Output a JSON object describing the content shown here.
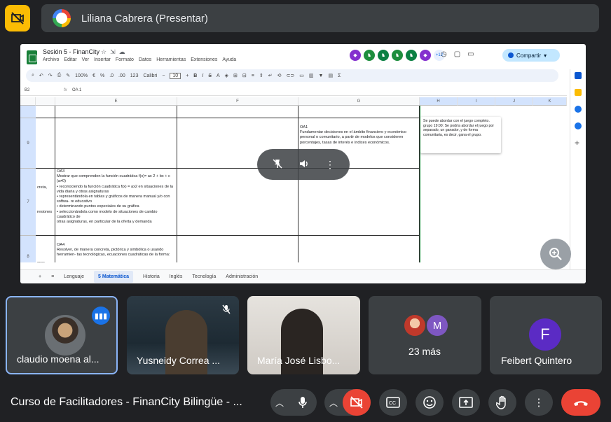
{
  "presenter": {
    "name": "Liliana Cabrera (Presentar)"
  },
  "spreadsheet": {
    "title": "Sesión 5 - FinanCity",
    "menu": [
      "Archivo",
      "Editar",
      "Ver",
      "Insertar",
      "Formato",
      "Datos",
      "Herramientas",
      "Extensiones",
      "Ayuda"
    ],
    "avatars_more": "+12",
    "share_label": "Compartir",
    "toolbar": {
      "zoom": "100%",
      "euro": "€",
      "percent": "%",
      "dec1": ".0",
      "dec2": ".00",
      "num": "123",
      "font": "Calibri",
      "font_size": "10",
      "sigma": "Σ"
    },
    "cell_ref": "B2",
    "formula_value": "OA 1",
    "columns": [
      "E",
      "F",
      "G",
      "H",
      "I",
      "J",
      "K"
    ],
    "rows": [
      "9",
      "7",
      "8"
    ],
    "cells": {
      "oa1": "OA1\nFundamentar decisiones en el ámbito financiero y económico personal o comunitario, a partir de modelos que consideren porcentajes, tasas de interés e índices económicos.",
      "oa3": "OA3\nMostrar que comprenden la función cuadrática f(x)= ax 2 + bx + c   (a≠0)\n• reconociendo la función cuadrática f(x) = ax2 en situaciones de la vida diaria y otras asignaturas\n• representándola en tablas y gráficos de manera manual y/o con softwa- re educativo\n• determinando puntos especiales de su gráfica\n• seleccionándola como modelo de situaciones de cambio cuadrático de\notras asignaturas, en particular de la oferta y demanda",
      "oa4": "OA4\nResolver, de manera concreta, pictórica y simbólica o usando herramien- tas tecnológicas, ecuaciones cuadráticas de la forma:",
      "left_partial_1": "creta,",
      "left_partial_2": "resiones",
      "left_partial_3": "ores"
    },
    "comment": "Se puede abordar con el juego completo.\ngrupo 19:00: Se podría abordar el juego por separado, un ganador, y de forma comunitaria, es decir, gana el grupo.",
    "sheet_tabs": [
      "Lenguaje",
      "Matemática",
      "Historia",
      "Inglés",
      "Tecnología",
      "Administración"
    ],
    "active_tab_badge": "5"
  },
  "participants": [
    {
      "name": "claudio moena al..."
    },
    {
      "name": "Yusneidy Correa ..."
    },
    {
      "name": "María José Lisbo..."
    },
    {
      "name": "23 más",
      "avatar_letter": "M"
    },
    {
      "name": "Feibert Quintero",
      "avatar_letter": "F"
    }
  ],
  "meeting": {
    "title": "Curso de Facilitadores - FinanCity Bilingüe - ..."
  },
  "colors": {
    "accent": "#8ab4f8",
    "danger": "#ea4335",
    "warning": "#fbbc04",
    "surface": "#3c4043",
    "bg": "#202124"
  }
}
